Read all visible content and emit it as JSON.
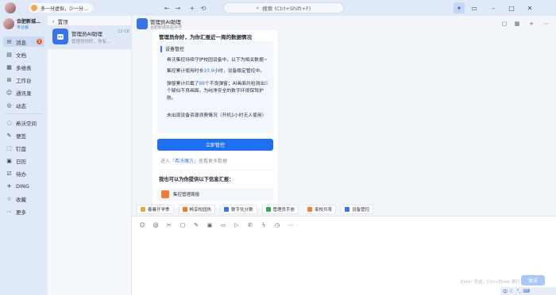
{
  "topbar": {
    "notice": "多一分虚拟，少一分…",
    "search_placeholder": "搜索 (Ctrl+Shift+F)"
  },
  "profile": {
    "name": "合肥新城…",
    "tag": "专业版"
  },
  "nav": {
    "items": [
      {
        "label": "消息",
        "icon": "chat-icon",
        "badge": "1"
      },
      {
        "label": "文档",
        "icon": "doc-icon"
      },
      {
        "label": "多维表",
        "icon": "table-icon"
      },
      {
        "label": "工作台",
        "icon": "grid-icon"
      },
      {
        "label": "通讯录",
        "icon": "contacts-icon"
      },
      {
        "label": "动态",
        "icon": "activity-icon"
      },
      {
        "label": "希沃空间",
        "icon": "space-icon"
      },
      {
        "label": "便签",
        "icon": "note-icon"
      },
      {
        "label": "钉盘",
        "icon": "drive-icon"
      },
      {
        "label": "日历",
        "icon": "calendar-icon"
      },
      {
        "label": "待办",
        "icon": "todo-icon"
      },
      {
        "label": "DING",
        "icon": "ding-icon"
      },
      {
        "label": "收藏",
        "icon": "star-icon"
      },
      {
        "label": "更多",
        "icon": "more-icon"
      }
    ]
  },
  "chatlist": {
    "back_label": "置顶",
    "item": {
      "name": "管理员AI助理",
      "time": "12-18",
      "preview": "管理员你好，你有..."
    }
  },
  "chat": {
    "title": "管理员AI助理",
    "subtitle": "合肥新城实验中学"
  },
  "card": {
    "title": "管理员你好，为你汇报近一周的数据情况",
    "section_label": "设备管控",
    "p1": "希沃集控持续守护校园设备中，以下为相关数据~",
    "p2_pre": "集控累计使用时长",
    "p2_val": "10.9",
    "p2_post": "小时，设备稳定管控中。",
    "p3_pre": "弹窗累计拦截了",
    "p3_val1": "88",
    "p3_mid": "个不良弹窗；AI画面共检测出",
    "p3_val2": "0",
    "p3_post": "个疑似不良画面。为纯净安全的数字环境保驾护航。",
    "p4": "未出现设备资源浪费情况（开机1小时无人使用）",
    "button": "立即管控",
    "enter_pre": "进入「",
    "enter_link": "希沃魔方",
    "enter_post": "」查看更多数据",
    "info_title": "我也可以为你提供以下信息汇报：",
    "info_item": "集控管理周报"
  },
  "chips": [
    {
      "label": "春暑开学季",
      "color": "#f0a53a"
    },
    {
      "label": "畅享校园热",
      "color": "#f07a33"
    },
    {
      "label": "数字化分数",
      "color": "#3a73e8"
    },
    {
      "label": "管理员手册",
      "color": "#2fa84f"
    },
    {
      "label": "家校共育",
      "color": "#f07a33"
    },
    {
      "label": "设备管控",
      "color": "#3a73e8"
    }
  ],
  "input": {
    "hint": "Enter 发送，Ctrl+Enter 换行",
    "send": "发送"
  },
  "ime": {
    "label": "中"
  }
}
